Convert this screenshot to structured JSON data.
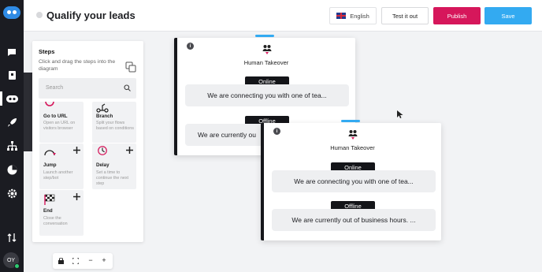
{
  "header": {
    "title": "Qualify your leads",
    "language": "English",
    "test_label": "Test it out",
    "publish_label": "Publish",
    "save_label": "Save"
  },
  "sidebar": {
    "icons": [
      "bot-logo-icon",
      "chat-icon",
      "contacts-icon",
      "bot-icon",
      "rocket-icon",
      "sitemap-icon",
      "reports-icon",
      "settings-icon",
      "sort-icon"
    ],
    "avatar_initials": "OY"
  },
  "steps_panel": {
    "title": "Steps",
    "description": "Click and drag the steps into the diagram",
    "search_placeholder": "Search",
    "tiles": [
      {
        "name": "Go to URL",
        "desc": "Open an URL on visitors browser"
      },
      {
        "name": "Branch",
        "desc": "Split your flows based on conditions"
      },
      {
        "name": "Jump",
        "desc": "Launch another step/bot"
      },
      {
        "name": "Delay",
        "desc": "Set a time to continue the next step"
      },
      {
        "name": "End",
        "desc": "Close the conversation"
      }
    ]
  },
  "toolbar": {
    "icons": [
      "lock-icon",
      "fit-screen-icon",
      "zoom-out-icon",
      "zoom-in-icon"
    ],
    "zoom_out": "−",
    "zoom_in": "+"
  },
  "nodes": [
    {
      "title": "Human Takeover",
      "online_label": "Online",
      "online_msg": "We are connecting you with one of tea...",
      "offline_label": "Offline",
      "offline_msg": "We are currently ou"
    },
    {
      "title": "Human Takeover",
      "online_label": "Online",
      "online_msg": "We are connecting you with one of tea...",
      "offline_label": "Offline",
      "offline_msg": "We are currently out of business hours. ..."
    }
  ],
  "colors": {
    "accent_blue": "#33aaf1",
    "publish_pink": "#d6175b",
    "rail_dark": "#1b1c22"
  }
}
